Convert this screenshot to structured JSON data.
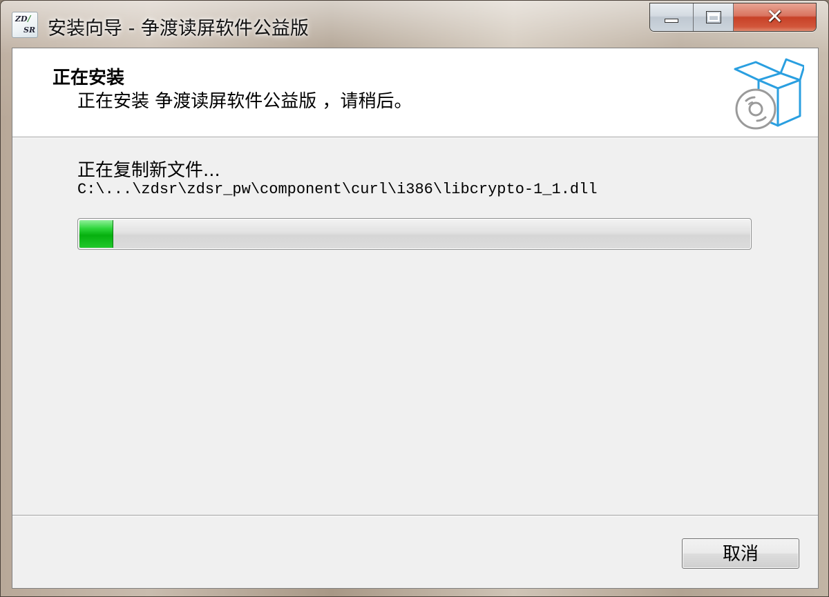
{
  "window": {
    "title": "安装向导 - 争渡读屏软件公益版",
    "app_icon_text_top": "ZD",
    "app_icon_text_bottom": "SR",
    "controls": {
      "minimize": "minimize-icon",
      "maximize": "maximize-icon",
      "close_glyph": "✕"
    }
  },
  "header": {
    "title": "正在安装",
    "subtitle": "正在安装 争渡读屏软件公益版 ，请稍后。",
    "icon": "software-box-cd-icon"
  },
  "progress": {
    "status": "正在复制新文件...",
    "file_path": "C:\\...\\zdsr\\zdsr_pw\\component\\curl\\i386\\libcrypto-1_1.dll",
    "percent": 5
  },
  "footer": {
    "cancel_label": "取消"
  },
  "colors": {
    "progress_green": "#06b00f",
    "close_red": "#c74127",
    "client_bg": "#f0f0f0",
    "box_blue": "#2a9fe0"
  }
}
